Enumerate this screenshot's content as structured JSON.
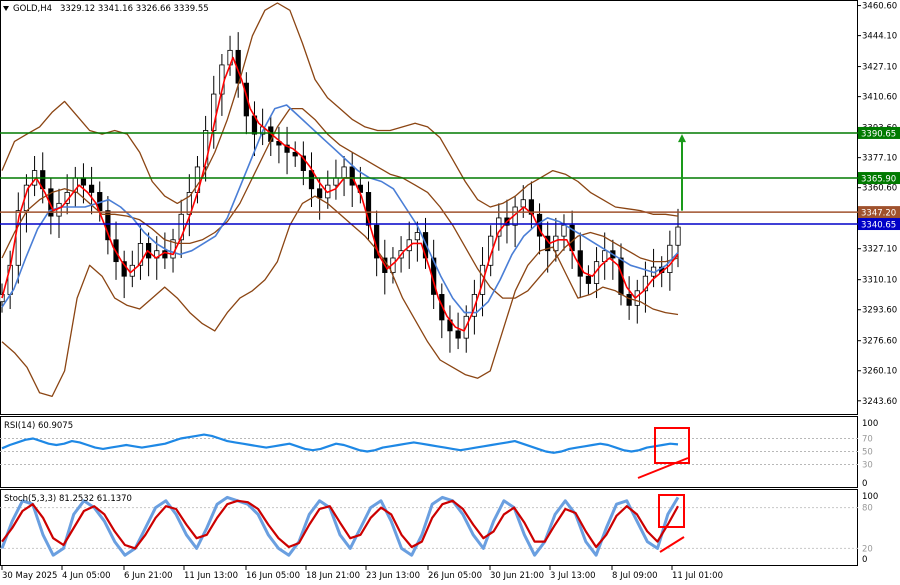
{
  "header": {
    "symbol_label": "GOLD,H4",
    "ohlc_text": "3329.12 3341.16 3326.66 3339.55",
    "menu_icon": "triangle-down-icon"
  },
  "chart_data": [
    {
      "type": "candlestick",
      "title": "GOLD,H4",
      "ylim": [
        3238,
        3462
      ],
      "y_ticks": [
        "3460.60",
        "3444.10",
        "3427.10",
        "3410.60",
        "3393.60",
        "3377.10",
        "3360.60",
        "3344.10",
        "3327.10",
        "3310.10",
        "3293.60",
        "3276.60",
        "3260.10",
        "3243.60"
      ],
      "x_labels": [
        "30 May 2025",
        "4 Jun 05:00",
        "6 Jun 21:00",
        "11 Jun 13:00",
        "16 Jun 05:00",
        "18 Jun 21:00",
        "23 Jun 13:00",
        "26 Jun 05:00",
        "30 Jun 21:00",
        "3 Jul 13:00",
        "8 Jul 09:00",
        "11 Jul 01:00"
      ],
      "horizontal_levels": [
        {
          "value": 3390.65,
          "label": "3390.65",
          "color": "#007a00"
        },
        {
          "value": 3365.9,
          "label": "3365.90",
          "color": "#007a00"
        },
        {
          "value": 3347.2,
          "label": "3347.20",
          "color": "#a0522d"
        },
        {
          "value": 3340.65,
          "label": "3340.65",
          "color": "#0000c8"
        }
      ],
      "annotation": {
        "type": "arrow-up",
        "from": 3348,
        "to": 3390,
        "color": "#1a9a1a"
      },
      "close_series": [
        3302,
        3318,
        3348,
        3362,
        3370,
        3360,
        3345,
        3352,
        3358,
        3366,
        3362,
        3358,
        3348,
        3332,
        3320,
        3312,
        3318,
        3330,
        3322,
        3326,
        3322,
        3332,
        3346,
        3358,
        3372,
        3392,
        3412,
        3428,
        3436,
        3418,
        3400,
        3390,
        3394,
        3386,
        3384,
        3380,
        3378,
        3370,
        3360,
        3355,
        3362,
        3366,
        3372,
        3362,
        3358,
        3340,
        3322,
        3314,
        3322,
        3326,
        3332,
        3336,
        3322,
        3302,
        3288,
        3282,
        3278,
        3290,
        3302,
        3318,
        3334,
        3344,
        3340,
        3350,
        3354,
        3346,
        3334,
        3326,
        3334,
        3340,
        3326,
        3312,
        3308,
        3320,
        3326,
        3322,
        3302,
        3296,
        3304,
        3312,
        3317,
        3314,
        3329,
        3339
      ],
      "bollinger_upper": [
        3370,
        3386,
        3390,
        3394,
        3402,
        3408,
        3400,
        3392,
        3390,
        3392,
        3390,
        3380,
        3364,
        3356,
        3352,
        3356,
        3366,
        3380,
        3398,
        3420,
        3444,
        3458,
        3462,
        3458,
        3440,
        3420,
        3410,
        3404,
        3398,
        3394,
        3392,
        3392,
        3394,
        3396,
        3394,
        3388,
        3376,
        3364,
        3354,
        3350,
        3352,
        3356,
        3362,
        3366,
        3370,
        3368,
        3364,
        3358,
        3354,
        3350,
        3349,
        3348,
        3346,
        3346,
        3345
      ],
      "bollinger_middle": [
        3322,
        3336,
        3348,
        3354,
        3358,
        3360,
        3358,
        3352,
        3346,
        3346,
        3345,
        3343,
        3338,
        3332,
        3330,
        3330,
        3332,
        3336,
        3342,
        3352,
        3366,
        3380,
        3394,
        3404,
        3404,
        3398,
        3390,
        3384,
        3380,
        3376,
        3372,
        3368,
        3366,
        3362,
        3358,
        3350,
        3340,
        3328,
        3316,
        3306,
        3300,
        3300,
        3304,
        3312,
        3320,
        3328,
        3334,
        3336,
        3334,
        3330,
        3326,
        3322,
        3320,
        3320,
        3322
      ],
      "bollinger_lower": [
        3276,
        3270,
        3262,
        3248,
        3246,
        3260,
        3300,
        3318,
        3312,
        3300,
        3296,
        3294,
        3300,
        3306,
        3300,
        3292,
        3286,
        3282,
        3292,
        3300,
        3304,
        3310,
        3320,
        3340,
        3352,
        3356,
        3352,
        3346,
        3340,
        3334,
        3326,
        3316,
        3300,
        3288,
        3276,
        3266,
        3262,
        3258,
        3256,
        3260,
        3282,
        3304,
        3318,
        3326,
        3328,
        3314,
        3300,
        3302,
        3306,
        3304,
        3300,
        3298,
        3294,
        3292,
        3291
      ],
      "ma_fast": [
        3300,
        3318,
        3345,
        3360,
        3366,
        3358,
        3348,
        3350,
        3356,
        3362,
        3358,
        3352,
        3340,
        3328,
        3320,
        3314,
        3318,
        3326,
        3322,
        3325,
        3324,
        3334,
        3346,
        3360,
        3378,
        3400,
        3420,
        3432,
        3420,
        3404,
        3396,
        3392,
        3388,
        3384,
        3382,
        3378,
        3372,
        3364,
        3358,
        3360,
        3366,
        3366,
        3356,
        3340,
        3324,
        3316,
        3320,
        3326,
        3330,
        3330,
        3316,
        3300,
        3290,
        3284,
        3282,
        3292,
        3306,
        3322,
        3336,
        3342,
        3346,
        3350,
        3346,
        3336,
        3330,
        3332,
        3332,
        3322,
        3314,
        3312,
        3318,
        3322,
        3318,
        3306,
        3300,
        3304,
        3310,
        3314,
        3318,
        3324
      ],
      "ma_slow": [
        3295,
        3305,
        3322,
        3338,
        3348,
        3350,
        3350,
        3350,
        3352,
        3354,
        3350,
        3344,
        3336,
        3330,
        3326,
        3324,
        3326,
        3330,
        3334,
        3344,
        3360,
        3376,
        3392,
        3404,
        3406,
        3400,
        3394,
        3388,
        3382,
        3376,
        3370,
        3366,
        3364,
        3360,
        3350,
        3340,
        3326,
        3312,
        3300,
        3292,
        3292,
        3298,
        3310,
        3324,
        3334,
        3340,
        3344,
        3342,
        3338,
        3334,
        3330,
        3326,
        3322,
        3318,
        3316,
        3314,
        3318,
        3325
      ],
      "panels": [
        {
          "name": "RSI(14)",
          "label": "RSI(14) 60.9075",
          "value": 60.9075,
          "ylim": [
            0,
            100
          ],
          "levels": [
            70,
            50,
            30
          ],
          "y_ticks": [
            "100",
            "0"
          ],
          "tick_values": [
            "70",
            "50",
            "30"
          ],
          "series": [
            55,
            60,
            64,
            68,
            70,
            66,
            62,
            60,
            62,
            66,
            64,
            60,
            56,
            54,
            56,
            58,
            60,
            58,
            56,
            58,
            60,
            62,
            66,
            70,
            72,
            74,
            76,
            74,
            70,
            66,
            64,
            62,
            60,
            58,
            56,
            58,
            60,
            62,
            58,
            54,
            52,
            54,
            58,
            62,
            60,
            56,
            52,
            50,
            52,
            56,
            58,
            60,
            62,
            64,
            62,
            60,
            58,
            56,
            54,
            52,
            54,
            56,
            58,
            60,
            62,
            64,
            66,
            62,
            58,
            54,
            50,
            48,
            50,
            54,
            56,
            58,
            60,
            62,
            60,
            56,
            52,
            50,
            52,
            56,
            58,
            60,
            62,
            61
          ]
        },
        {
          "name": "Stoch(5,3,3)",
          "label": "Stoch(5,3,3) 81.2532 61.1370",
          "main_value": 81.2532,
          "signal_value": 61.137,
          "ylim": [
            0,
            100
          ],
          "y_ticks": [
            "100",
            "0"
          ],
          "tick_values": [
            "80",
            "20"
          ],
          "main": [
            20,
            60,
            90,
            85,
            40,
            10,
            20,
            70,
            90,
            80,
            60,
            30,
            10,
            20,
            50,
            80,
            90,
            70,
            40,
            20,
            50,
            85,
            95,
            90,
            85,
            70,
            40,
            20,
            10,
            30,
            70,
            90,
            80,
            40,
            20,
            50,
            80,
            90,
            60,
            20,
            10,
            40,
            85,
            95,
            90,
            70,
            40,
            20,
            60,
            90,
            80,
            40,
            10,
            30,
            70,
            90,
            70,
            30,
            10,
            50,
            85,
            90,
            60,
            30,
            20,
            70,
            95
          ],
          "signal": [
            30,
            50,
            75,
            85,
            65,
            35,
            25,
            50,
            75,
            82,
            70,
            45,
            25,
            20,
            40,
            65,
            82,
            78,
            55,
            35,
            40,
            65,
            85,
            90,
            88,
            78,
            55,
            35,
            22,
            28,
            55,
            78,
            82,
            58,
            35,
            40,
            65,
            80,
            70,
            40,
            22,
            30,
            65,
            85,
            90,
            78,
            55,
            35,
            45,
            70,
            80,
            58,
            30,
            30,
            55,
            78,
            72,
            45,
            22,
            40,
            68,
            82,
            70,
            45,
            30,
            55,
            82
          ],
          "signal_color": "#cc0000",
          "main_color": "#6a9fe0"
        }
      ]
    }
  ],
  "colors": {
    "candle": "#000000",
    "bollinger": "#8b4513",
    "ma_fast": "#ff0000",
    "ma_slow": "#4a7ed6",
    "rsi": "#1e88e5",
    "highlight_box": "#ff0000",
    "arrow": "#1a9a1a"
  }
}
